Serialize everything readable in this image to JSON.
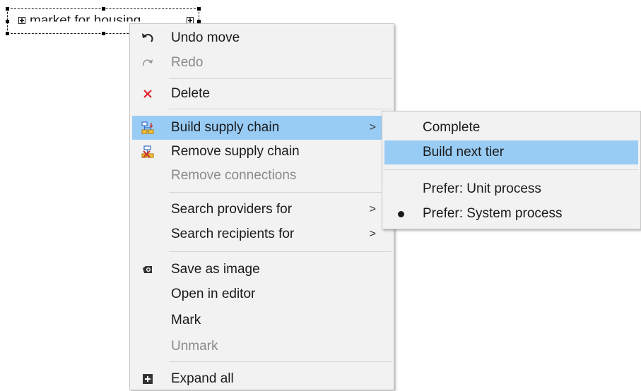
{
  "node": {
    "label": "market for housing"
  },
  "context_menu": {
    "items": [
      {
        "label": "Undo move",
        "icon": "undo-icon",
        "enabled": true
      },
      {
        "label": "Redo",
        "icon": "redo-icon",
        "enabled": false
      },
      {
        "label": "Delete",
        "icon": "delete-icon",
        "enabled": true
      },
      {
        "label": "Build supply chain",
        "icon": "build-supply-chain-icon",
        "enabled": true,
        "has_submenu": true,
        "highlighted": true
      },
      {
        "label": "Remove supply chain",
        "icon": "remove-supply-chain-icon",
        "enabled": true
      },
      {
        "label": "Remove connections",
        "enabled": false
      },
      {
        "label": "Search providers for",
        "enabled": true,
        "has_submenu": true
      },
      {
        "label": "Search recipients for",
        "enabled": true,
        "has_submenu": true
      },
      {
        "label": "Save as image",
        "icon": "camera-icon",
        "enabled": true
      },
      {
        "label": "Open in editor",
        "enabled": true
      },
      {
        "label": "Mark",
        "enabled": true
      },
      {
        "label": "Unmark",
        "enabled": false
      },
      {
        "label": "Expand all",
        "icon": "expand-icon",
        "enabled": true
      }
    ],
    "submenu_arrow": ">"
  },
  "submenu": {
    "items": [
      {
        "label": "Complete",
        "enabled": true
      },
      {
        "label": "Build next tier",
        "enabled": true,
        "highlighted": true
      },
      {
        "label": "Prefer: Unit process",
        "enabled": true,
        "checked": false
      },
      {
        "label": "Prefer: System process",
        "enabled": true,
        "checked": true
      }
    ]
  },
  "colors": {
    "highlight": "#99ccf5",
    "menu_background": "#f2f2f2",
    "delete_icon": "#e0202a",
    "disabled_text": "#8a8a8a"
  }
}
